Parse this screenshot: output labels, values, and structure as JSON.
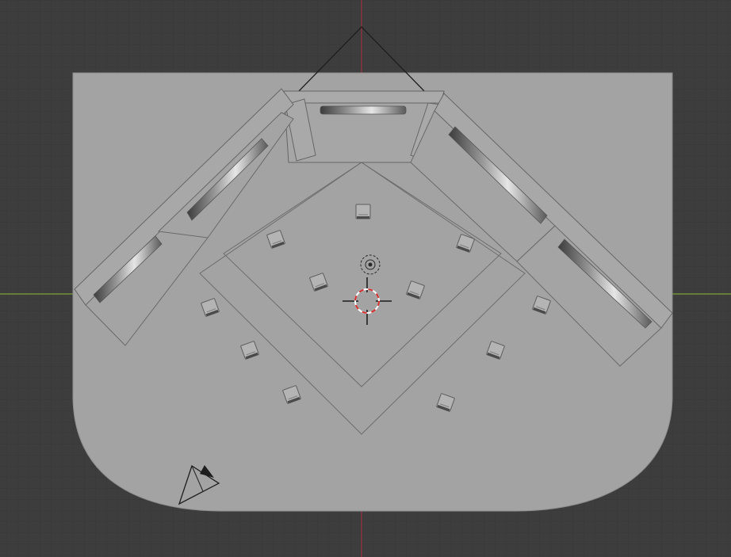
{
  "viewport": {
    "view": "top-orthographic",
    "grid": true,
    "colors": {
      "background": "#3d3d3d",
      "grid_minor": "#363636",
      "grid_major": "#303030",
      "x_axis": "#80a23a",
      "y_axis": "#9b2f3f",
      "floor": "#a3a3a3",
      "wireframe": "#6e6e6e",
      "cursor_ring_white": "#ffffff",
      "cursor_ring_red": "#d62d2d"
    }
  },
  "scene_objects": [
    {
      "name": "floor-plane",
      "type": "mesh"
    },
    {
      "name": "display-frame-left",
      "type": "mesh"
    },
    {
      "name": "display-frame-center",
      "type": "mesh"
    },
    {
      "name": "display-frame-right",
      "type": "mesh"
    },
    {
      "name": "inner-diamond-platform",
      "type": "mesh"
    },
    {
      "name": "outer-diamond-platform",
      "type": "mesh"
    },
    {
      "name": "spotlight-lamps",
      "type": "light",
      "count": 13
    },
    {
      "name": "point-light",
      "type": "light"
    },
    {
      "name": "scene-camera",
      "type": "camera"
    },
    {
      "name": "3d-cursor",
      "type": "cursor"
    }
  ]
}
